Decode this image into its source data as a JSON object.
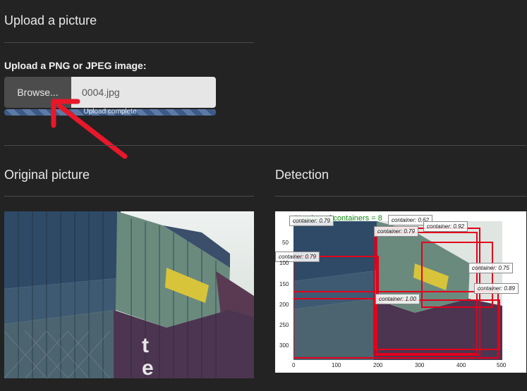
{
  "upload": {
    "title": "Upload a picture",
    "label": "Upload a PNG or JPEG image:",
    "browse_label": "Browse...",
    "file_name": "0004.jpg",
    "progress_text": "Upload complete",
    "progress": 1.0
  },
  "original": {
    "title": "Original picture"
  },
  "detection": {
    "title": "Detection",
    "count_text": "Number of containers = 8",
    "labels": [
      "container: 0.79",
      "container: 0.62",
      "container: 0.79",
      "container: 0.92",
      "container: 0.79",
      "container: 0.75",
      "container: 0.89",
      "container: 1.00"
    ],
    "y_ticks": [
      "50",
      "100",
      "150",
      "200",
      "250",
      "300"
    ],
    "x_ticks": [
      "0",
      "100",
      "200",
      "300",
      "400",
      "500"
    ]
  },
  "colors": {
    "box": "#e3001b",
    "arrow": "#e8182a",
    "count_text": "#108a10"
  }
}
